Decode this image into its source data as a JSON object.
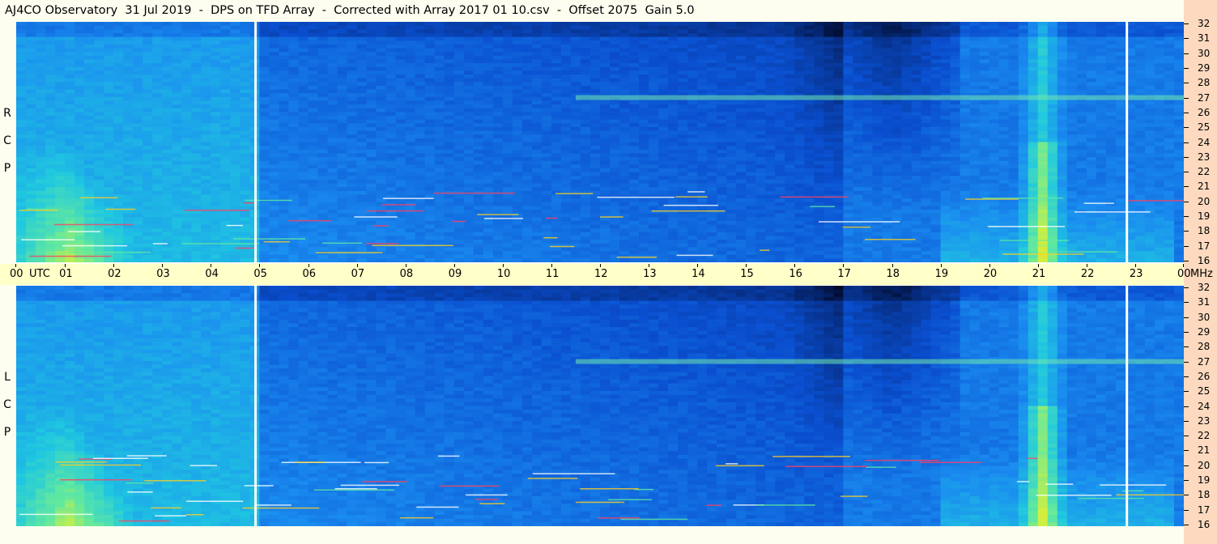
{
  "title": "AJ4CO Observatory  31 Jul 2019  -  DPS on TFD Array  -  Corrected with Array 2017 01 10.csv  -  Offset 2075  Gain 5.0",
  "colors": {
    "background": "#fdfdf0",
    "time_bar": "#ffffc8",
    "right_strip": "#fcd9bf",
    "colormap": [
      "#000010",
      "#062a7a",
      "#0a4fd0",
      "#1a8cf0",
      "#20c8e0",
      "#60e8a0",
      "#d0f040",
      "#ffd020",
      "#ff4060",
      "#ffffff"
    ]
  },
  "panels": [
    {
      "name": "RCP",
      "label_letters": [
        "R",
        "C",
        "P"
      ]
    },
    {
      "name": "LCP",
      "label_letters": [
        "L",
        "C",
        "P"
      ]
    }
  ],
  "time_axis": {
    "labels": [
      "00",
      "UTC",
      "01",
      "02",
      "03",
      "04",
      "05",
      "06",
      "07",
      "08",
      "09",
      "10",
      "11",
      "12",
      "13",
      "14",
      "15",
      "16",
      "17",
      "18",
      "19",
      "20",
      "21",
      "22",
      "23",
      "00",
      "MHz"
    ]
  },
  "chart_data": {
    "type": "heatmap",
    "title": "AJ4CO Observatory  31 Jul 2019  -  DPS on TFD Array  -  Corrected with Array 2017 01 10.csv  -  Offset 2075  Gain 5.0",
    "x": {
      "label": "UTC",
      "range": [
        0,
        24
      ],
      "ticks": [
        "00",
        "01",
        "02",
        "03",
        "04",
        "05",
        "06",
        "07",
        "08",
        "09",
        "10",
        "11",
        "12",
        "13",
        "14",
        "15",
        "16",
        "17",
        "18",
        "19",
        "20",
        "21",
        "22",
        "23",
        "00"
      ]
    },
    "y": {
      "label": "MHz",
      "range": [
        16,
        32
      ],
      "ticks": [
        32,
        31,
        30,
        29,
        28,
        27,
        26,
        25,
        24,
        23,
        22,
        21,
        20,
        19,
        18,
        17,
        16
      ]
    },
    "panels": [
      "RCP",
      "LCP"
    ],
    "data_gaps_utc": [
      4.92,
      22.83
    ],
    "features": {
      "strong_broadband_emission_utc": [
        20.9,
        21.3
      ],
      "dark_low_intensity_region_utc": [
        17.0,
        19.0
      ],
      "persistent_band_mhz": 27.0,
      "solar_bright_region_utc": [
        0,
        2.5
      ]
    }
  }
}
